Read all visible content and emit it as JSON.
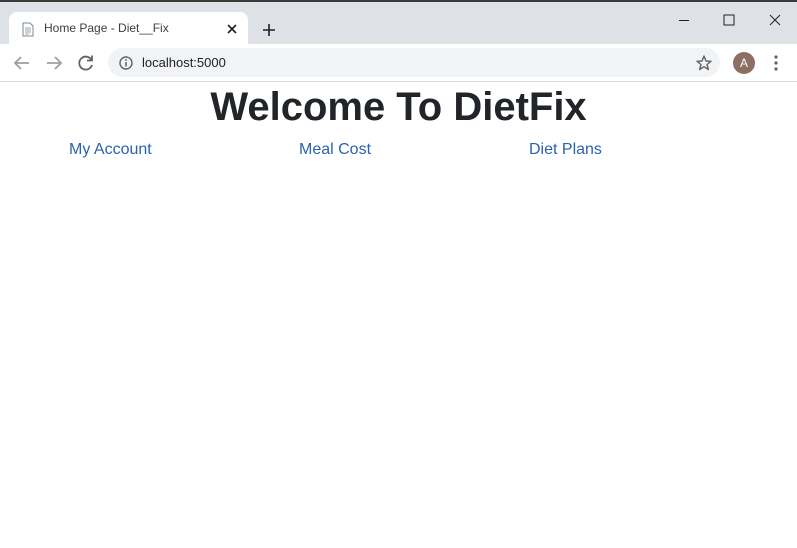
{
  "browser": {
    "tab_title": "Home Page - Diet__Fix",
    "url": "localhost:5000",
    "profile_initial": "A"
  },
  "page": {
    "heading": "Welcome To DietFix",
    "links": [
      {
        "label": "My Account"
      },
      {
        "label": "Meal Cost"
      },
      {
        "label": "Diet Plans"
      }
    ]
  },
  "colors": {
    "link": "#2a62b1",
    "heading": "#212529",
    "tabstrip": "#dee1e6"
  }
}
